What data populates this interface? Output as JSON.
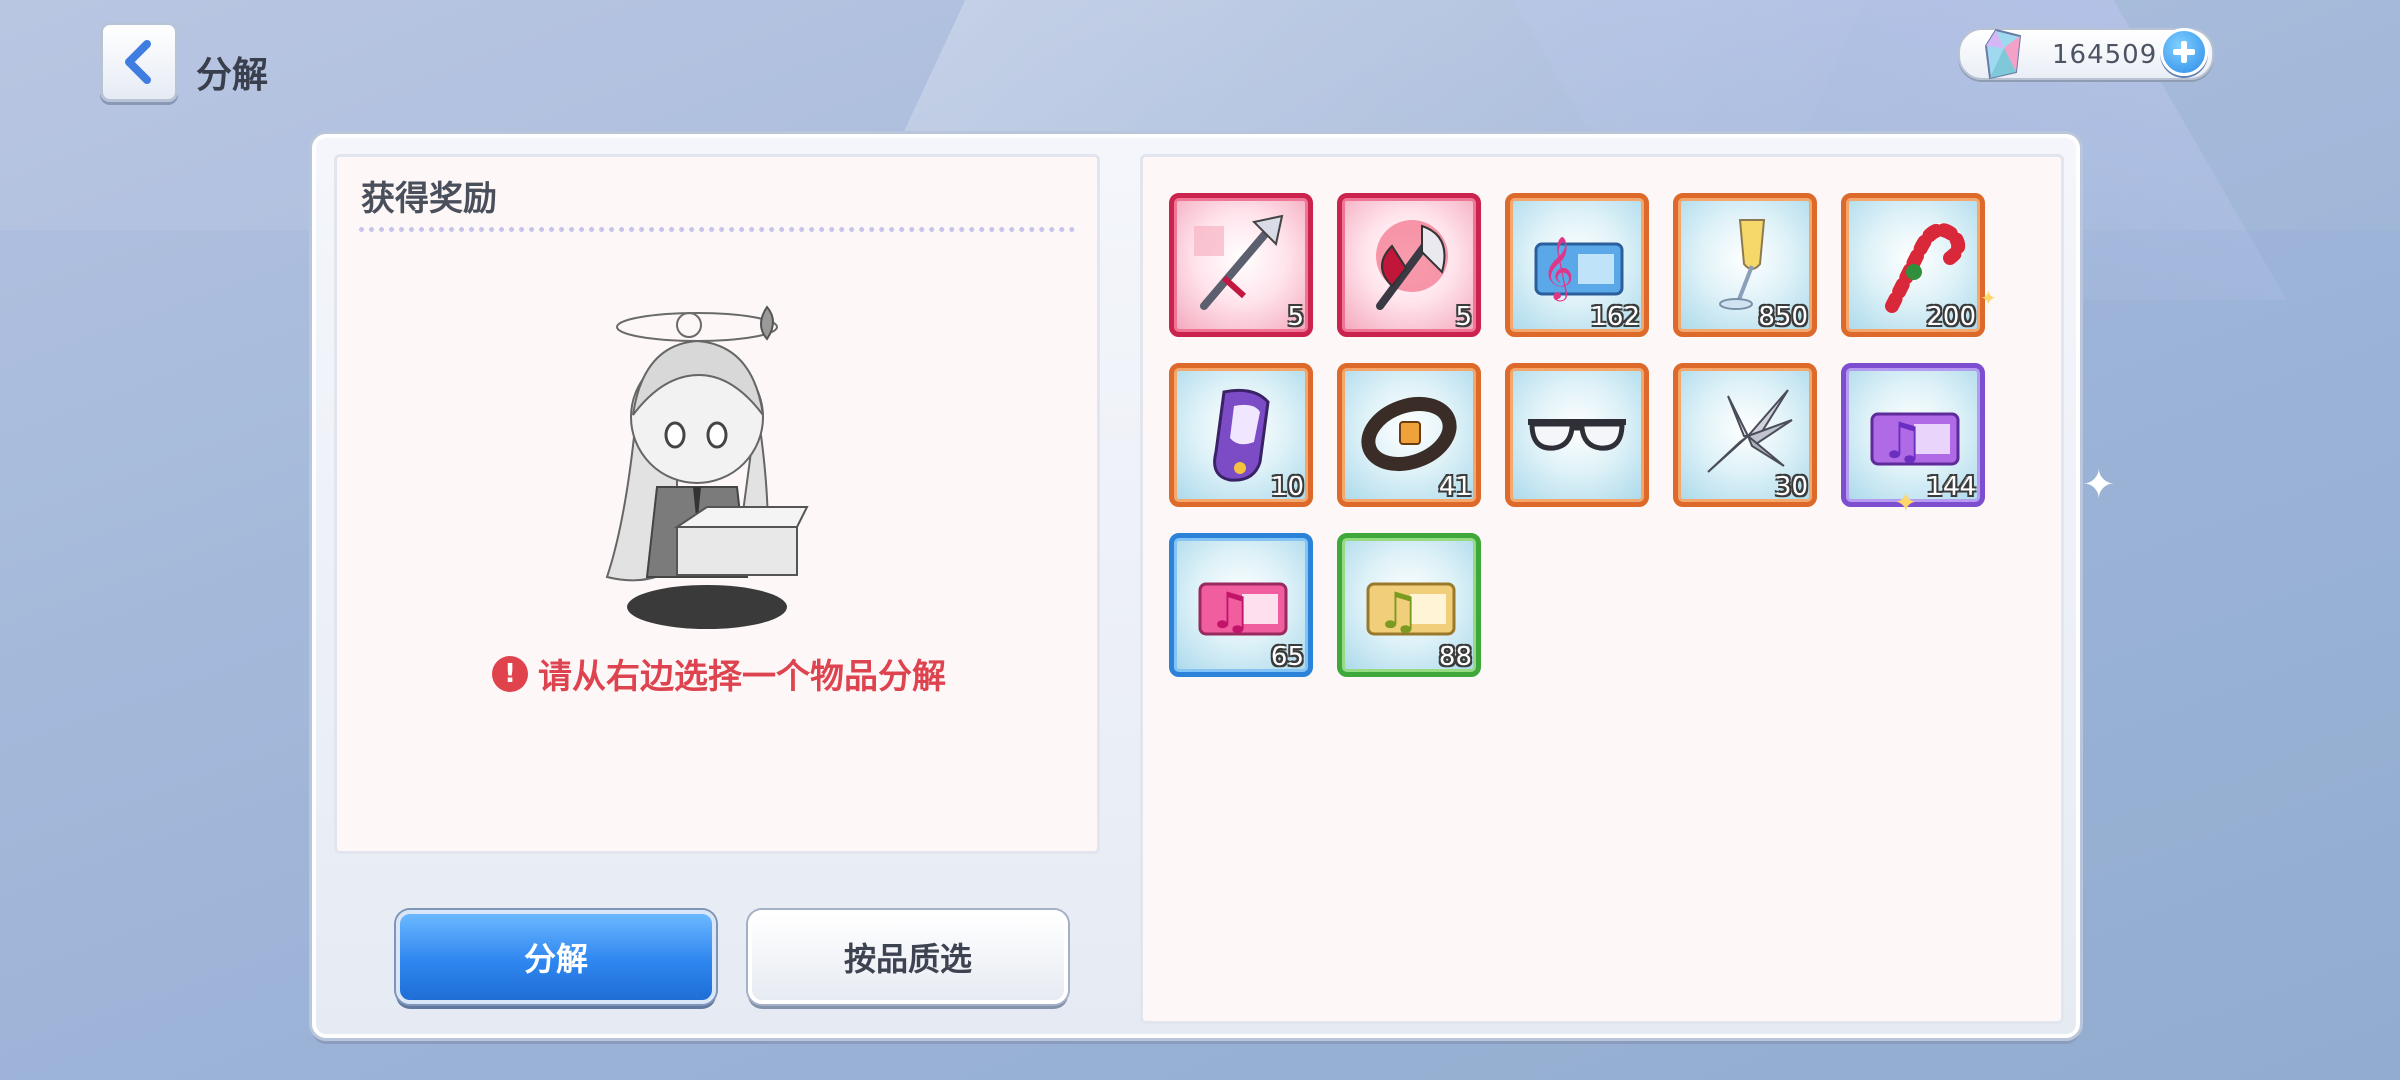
{
  "header": {
    "title": "分解",
    "currency_amount": "164509"
  },
  "left_panel": {
    "heading": "获得奖励",
    "hint": "请从右边选择一个物品分解",
    "warning_glyph": "!"
  },
  "buttons": {
    "disassemble": "分解",
    "select_by_quality": "按品质选"
  },
  "items": [
    {
      "name": "red-spear-weapon",
      "rarity": "red",
      "count": "5"
    },
    {
      "name": "red-axe-weapon",
      "rarity": "red",
      "count": "5"
    },
    {
      "name": "music-score-ticket-blue",
      "rarity": "orange",
      "count": "162"
    },
    {
      "name": "champagne-glass",
      "rarity": "orange",
      "count": "850"
    },
    {
      "name": "candy-cane",
      "rarity": "orange",
      "count": "200"
    },
    {
      "name": "purple-shoe",
      "rarity": "orange",
      "count": "10"
    },
    {
      "name": "leather-bracelet",
      "rarity": "orange",
      "count": "41"
    },
    {
      "name": "sunglasses",
      "rarity": "orange",
      "count": ""
    },
    {
      "name": "feather-wings",
      "rarity": "orange",
      "count": "30"
    },
    {
      "name": "music-score-ticket-purple",
      "rarity": "purple",
      "count": "144"
    },
    {
      "name": "music-score-ticket-pink",
      "rarity": "blue",
      "count": "65"
    },
    {
      "name": "music-score-ticket-gold",
      "rarity": "green",
      "count": "88"
    }
  ],
  "colors": {
    "primary_button": "#2f86ef",
    "hint_red": "#de4450",
    "rarity_red": "#c9234e",
    "rarity_orange": "#dd6a2a",
    "rarity_purple": "#7d4fd0",
    "rarity_blue": "#2a83d8",
    "rarity_green": "#3fa83a"
  }
}
